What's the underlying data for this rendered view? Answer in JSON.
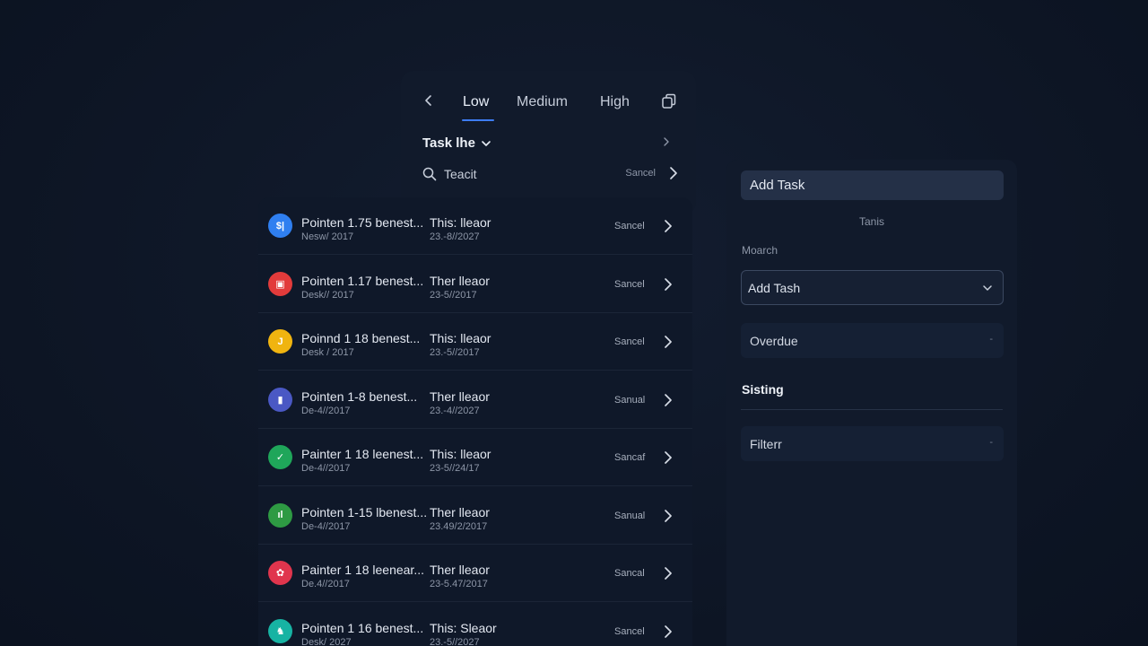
{
  "header": {
    "tabs": [
      {
        "label": "Low"
      },
      {
        "label": "Medium"
      },
      {
        "label": "High"
      }
    ],
    "list_title": "Task lhe",
    "search_text": "Teacit",
    "search_status": "Sancel"
  },
  "tasks": [
    {
      "icon_text": "$|",
      "icon_color": "#2f7ff0",
      "name": "Pointen 1.75 benest...",
      "date": "Nesw/ 2017",
      "owner": "This: lleaor",
      "due": "23.-8//2027",
      "status": "Sancel"
    },
    {
      "icon_text": "▣",
      "icon_color": "#e23b3b",
      "name": "Pointen 1.17 benest...",
      "date": "Desk// 2017",
      "owner": "Ther lleaor",
      "due": "23-5//2017",
      "status": "Sancel"
    },
    {
      "icon_text": "J",
      "icon_color": "#f0b410",
      "name": "Poinnd 1 18 benest...",
      "date": "Desk / 2017",
      "owner": "This: lleaor",
      "due": "23.-5//2017",
      "status": "Sancel"
    },
    {
      "icon_text": "▮",
      "icon_color": "#4a58c4",
      "name": "Pointen 1-8 benest...",
      "date": "De-4//2017",
      "owner": "Ther lleaor",
      "due": "23.-4//2027",
      "status": "Sanual"
    },
    {
      "icon_text": "✓",
      "icon_color": "#1fa65a",
      "name": "Painter 1 18 leenest...",
      "date": "De-4//2017",
      "owner": "This: lleaor",
      "due": "23-5//24/17",
      "status": "Sancaf"
    },
    {
      "icon_text": "ıl",
      "icon_color": "#2e9a43",
      "name": "Pointen 1-15 lbenest...",
      "date": "De-4//2017",
      "owner": "Ther lleaor",
      "due": "23.49/2/2017",
      "status": "Sanual"
    },
    {
      "icon_text": "✿",
      "icon_color": "#e0354d",
      "name": "Painter 1 18 leenear...",
      "date": "De.4//2017",
      "owner": "Ther lleaor",
      "due": "23-5.47/2017",
      "status": "Sancal"
    },
    {
      "icon_text": "♞",
      "icon_color": "#17b3a3",
      "name": "Pointen 1 16 benest...",
      "date": "Desk/ 2027",
      "owner": "This: Sleaor",
      "due": "23.-5//2027",
      "status": "Sancel"
    }
  ],
  "side": {
    "add_task": "Add Task",
    "tasks_caption": "Tanis",
    "search_label": "Moarch",
    "select_value": "Add Tash",
    "overdue": "Overdue",
    "section_title": "Sisting",
    "filter": "Filterr",
    "dash": "-"
  },
  "colors": {
    "accent": "#3d7cf2",
    "panel": "#111a2b",
    "background": "#0e1626"
  }
}
